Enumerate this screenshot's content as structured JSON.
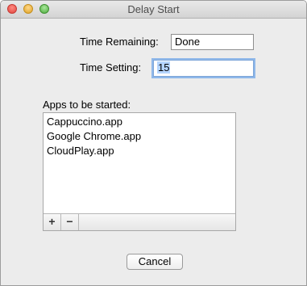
{
  "window": {
    "title": "Delay Start"
  },
  "form": {
    "time_remaining_label": "Time Remaining:",
    "time_remaining_value": "Done",
    "time_setting_label": "Time Setting:",
    "time_setting_value": "15"
  },
  "apps": {
    "label": "Apps to be started:",
    "items": [
      {
        "name": "Cappuccino.app"
      },
      {
        "name": "Google Chrome.app"
      },
      {
        "name": "CloudPlay.app"
      }
    ],
    "add_label": "+",
    "remove_label": "−"
  },
  "actions": {
    "cancel_label": "Cancel"
  },
  "colors": {
    "focus_ring": "#8fb8ea",
    "selection": "#b5d5ff",
    "close": "#e0443e",
    "minimize": "#dea123",
    "zoom": "#4fab3f"
  }
}
